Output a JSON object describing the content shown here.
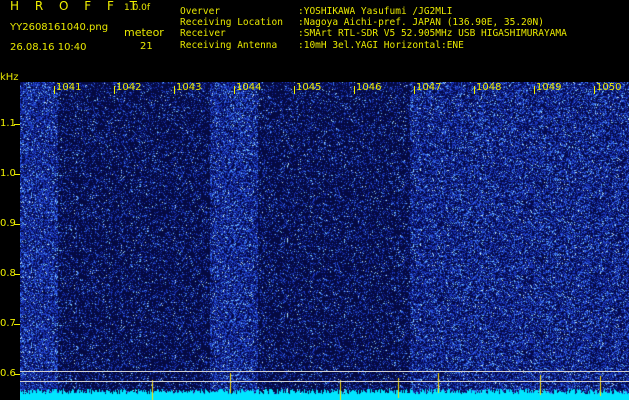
{
  "header": {
    "title": "H R O F F T",
    "version": "1.0.0f",
    "filename": "YY2608161040.png",
    "timestamp": "26.08.16 10:40",
    "category_label": "meteor",
    "count": "21"
  },
  "info": [
    {
      "key": "Overver",
      "value": ":YOSHIKAWA Yasufumi /JG2MLI"
    },
    {
      "key": "Receiving Location",
      "value": ":Nagoya Aichi-pref. JAPAN (136.90E, 35.20N)"
    },
    {
      "key": "Receiver",
      "value": ":SMArt RTL-SDR V5 52.905MHz USB HIGASHIMURAYAMA"
    },
    {
      "key": "Receiving Antenna",
      "value": ":10mH 3el.YAGI Horizontal:ENE"
    }
  ],
  "axes": {
    "y_unit": "kHz",
    "x_ticks": [
      "1041",
      "1042",
      "1043",
      "1044",
      "1045",
      "1046",
      "1047",
      "1048",
      "1049",
      "1050"
    ],
    "y_ticks": [
      "1.1",
      "1.0",
      "0.9",
      "0.8",
      "0.7",
      "0.6"
    ]
  },
  "colors": {
    "text": "#e8e800",
    "background": "#000000",
    "noise": "#1a2a9a",
    "baseline": "#00e5ff"
  }
}
